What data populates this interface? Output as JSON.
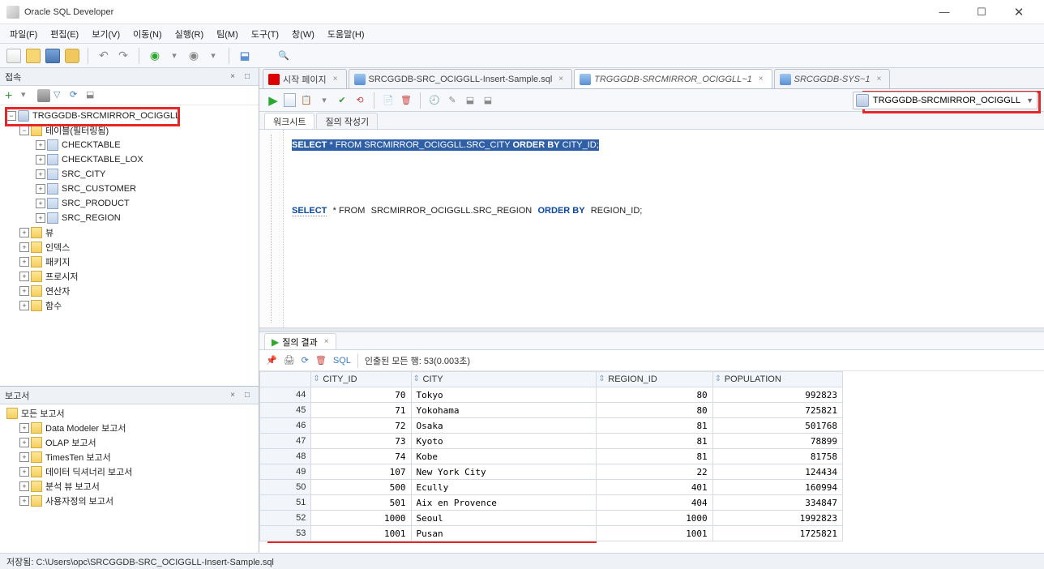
{
  "window": {
    "title": "Oracle SQL Developer"
  },
  "menu": [
    "파일(F)",
    "편집(E)",
    "보기(V)",
    "이동(N)",
    "실행(R)",
    "팀(M)",
    "도구(T)",
    "창(W)",
    "도움말(H)"
  ],
  "left": {
    "connections": {
      "title": "접속",
      "toolbar": true,
      "selected_conn": "TRGGGDB-SRCMIRROR_OCIGGLL",
      "tables_folder": "테이블(필터링됨)",
      "tables": [
        "CHECKTABLE",
        "CHECKTABLE_LOX",
        "SRC_CITY",
        "SRC_CUSTOMER",
        "SRC_PRODUCT",
        "SRC_REGION"
      ],
      "view_folder": "뷰",
      "other_folders": [
        "인덱스",
        "패키지",
        "프로시저",
        "연산자",
        "함수"
      ]
    },
    "reports": {
      "title": "보고서",
      "root": "모든 보고서",
      "items": [
        "Data Modeler 보고서",
        "OLAP 보고서",
        "TimesTen 보고서",
        "데이터 딕셔너리 보고서",
        "분석 뷰 보고서",
        "사용자정의 보고서"
      ]
    }
  },
  "editor": {
    "tabs": [
      {
        "label": "시작 페이지",
        "type": "start",
        "active": false,
        "closable": true
      },
      {
        "label": "SRCGGDB-SRC_OCIGGLL-Insert-Sample.sql",
        "type": "sql",
        "active": false,
        "closable": true
      },
      {
        "label": "TRGGGDB-SRCMIRROR_OCIGGLL~1",
        "type": "sql",
        "active": true,
        "italic": true,
        "closable": true
      },
      {
        "label": "SRCGGDB-SYS~1",
        "type": "sql",
        "active": false,
        "italic": true,
        "closable": true
      }
    ],
    "connection": "TRGGGDB-SRCMIRROR_OCIGGLL",
    "ws_tab": "워크시트",
    "ws_tab2": "질의 작성기",
    "sql1_pre": "SELECT",
    "sql1_mid": "* FROM",
    "sql1_schema": "SRCMIRROR_OCIGGLL.SRC_CITY",
    "sql1_ord": "ORDER BY",
    "sql1_col": "CITY_ID;",
    "sql2_pre": "SELECT",
    "sql2_mid": "* FROM",
    "sql2_schema": "SRCMIRROR_OCIGGLL.SRC_REGION",
    "sql2_ord": "ORDER BY",
    "sql2_col": "REGION_ID;"
  },
  "results": {
    "tab": "질의 결과",
    "sql_link": "SQL",
    "status": "인출된 모든 행: 53(0.003초)",
    "columns": [
      "CITY_ID",
      "CITY",
      "REGION_ID",
      "POPULATION"
    ],
    "rows": [
      {
        "n": 44,
        "city_id": 70,
        "city": "Tokyo",
        "region_id": 80,
        "pop": 992823
      },
      {
        "n": 45,
        "city_id": 71,
        "city": "Yokohama",
        "region_id": 80,
        "pop": 725821
      },
      {
        "n": 46,
        "city_id": 72,
        "city": "Osaka",
        "region_id": 81,
        "pop": 501768
      },
      {
        "n": 47,
        "city_id": 73,
        "city": "Kyoto",
        "region_id": 81,
        "pop": 78899
      },
      {
        "n": 48,
        "city_id": 74,
        "city": "Kobe",
        "region_id": 81,
        "pop": 81758
      },
      {
        "n": 49,
        "city_id": 107,
        "city": "New York City",
        "region_id": 22,
        "pop": 124434
      },
      {
        "n": 50,
        "city_id": 500,
        "city": "Ecully",
        "region_id": 401,
        "pop": 160994
      },
      {
        "n": 51,
        "city_id": 501,
        "city": "Aix en Provence",
        "region_id": 404,
        "pop": 334847
      },
      {
        "n": 52,
        "city_id": 1000,
        "city": "Seoul",
        "region_id": 1000,
        "pop": 1992823
      },
      {
        "n": 53,
        "city_id": 1001,
        "city": "Pusan",
        "region_id": 1001,
        "pop": 1725821
      }
    ]
  },
  "status": "저장됨: C:\\Users\\opc\\SRCGGDB-SRC_OCIGGLL-Insert-Sample.sql"
}
